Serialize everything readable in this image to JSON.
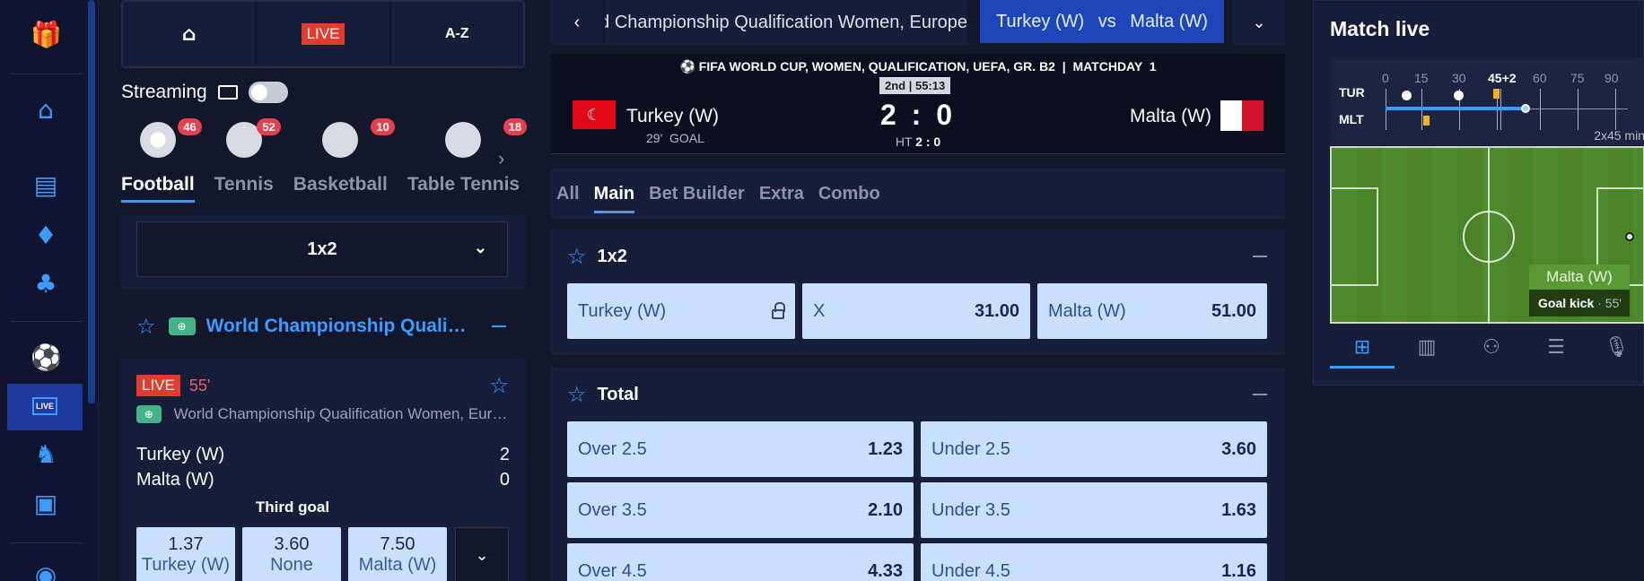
{
  "topnav": {
    "home_icon": "home-icon",
    "live_label": "LIVE",
    "az_label": "A-Z"
  },
  "streaming": {
    "label": "Streaming",
    "enabled": false
  },
  "sports": [
    {
      "name": "Football",
      "count": "46",
      "active": true
    },
    {
      "name": "Tennis",
      "count": "52",
      "active": false
    },
    {
      "name": "Basketball",
      "count": "10",
      "active": false
    },
    {
      "name": "Table Tennis",
      "count": "18",
      "active": false
    }
  ],
  "market_selector": {
    "value": "1x2"
  },
  "league": {
    "name": "World Championship Qualification Women, Europe"
  },
  "live_card": {
    "live_label": "LIVE",
    "minute": "55'",
    "league": "World Championship Qualification Women, Europe",
    "home": {
      "name": "Turkey (W)",
      "score": "2"
    },
    "away": {
      "name": "Malta (W)",
      "score": "0"
    },
    "market_title": "Third goal",
    "odds": [
      {
        "value": "1.37",
        "label": "Turkey (W)"
      },
      {
        "value": "3.60",
        "label": "None"
      },
      {
        "value": "7.50",
        "label": "Malta (W)"
      }
    ]
  },
  "event": {
    "competition": "World Championship Qualification Women, Europe",
    "vs_home": "Turkey (W)",
    "vs_sep": "vs",
    "vs_away": "Malta (W)",
    "header": "FIFA WORLD CUP, WOMEN, QUALIFICATION, UEFA, GR. B2  |  MATCHDAY  1",
    "period": "2nd | 55:13",
    "home": "Turkey (W)",
    "away": "Malta (W)",
    "score": "2 : 0",
    "goal_note": "29'  GOAL",
    "ht_label": "HT",
    "ht_score": "2 : 0"
  },
  "market_tabs": [
    {
      "label": "All",
      "active": false
    },
    {
      "label": "Main",
      "active": true
    },
    {
      "label": "Bet Builder",
      "active": false
    },
    {
      "label": "Extra",
      "active": false
    },
    {
      "label": "Combo",
      "active": false
    }
  ],
  "markets": {
    "one_x_two": {
      "title": "1x2",
      "selections": [
        {
          "name": "Turkey (W)",
          "odds": "",
          "locked": true
        },
        {
          "name": "X",
          "odds": "31.00"
        },
        {
          "name": "Malta (W)",
          "odds": "51.00"
        }
      ]
    },
    "total": {
      "title": "Total",
      "rows": [
        {
          "over": "Over 2.5",
          "over_odds": "1.23",
          "under": "Under 2.5",
          "under_odds": "3.60"
        },
        {
          "over": "Over 3.5",
          "over_odds": "2.10",
          "under": "Under 3.5",
          "under_odds": "1.63"
        },
        {
          "over": "Over 4.5",
          "over_odds": "4.33",
          "under": "Under 4.5",
          "under_odds": "1.16"
        }
      ]
    }
  },
  "match_live": {
    "title": "Match live",
    "ticks": [
      "0",
      "15",
      "30",
      "45+2",
      "60",
      "75",
      "90"
    ],
    "home_abbr": "TUR",
    "away_abbr": "MLT",
    "duration": "2x45 min",
    "progress_minute": 55,
    "event_team": "Malta (W)",
    "event_name": "Goal kick",
    "event_minute": "55'"
  },
  "colors": {
    "accent": "#3b9bff",
    "live": "#e33b2c",
    "odds_bg": "#c9e0fd",
    "bg": "#12172b"
  }
}
